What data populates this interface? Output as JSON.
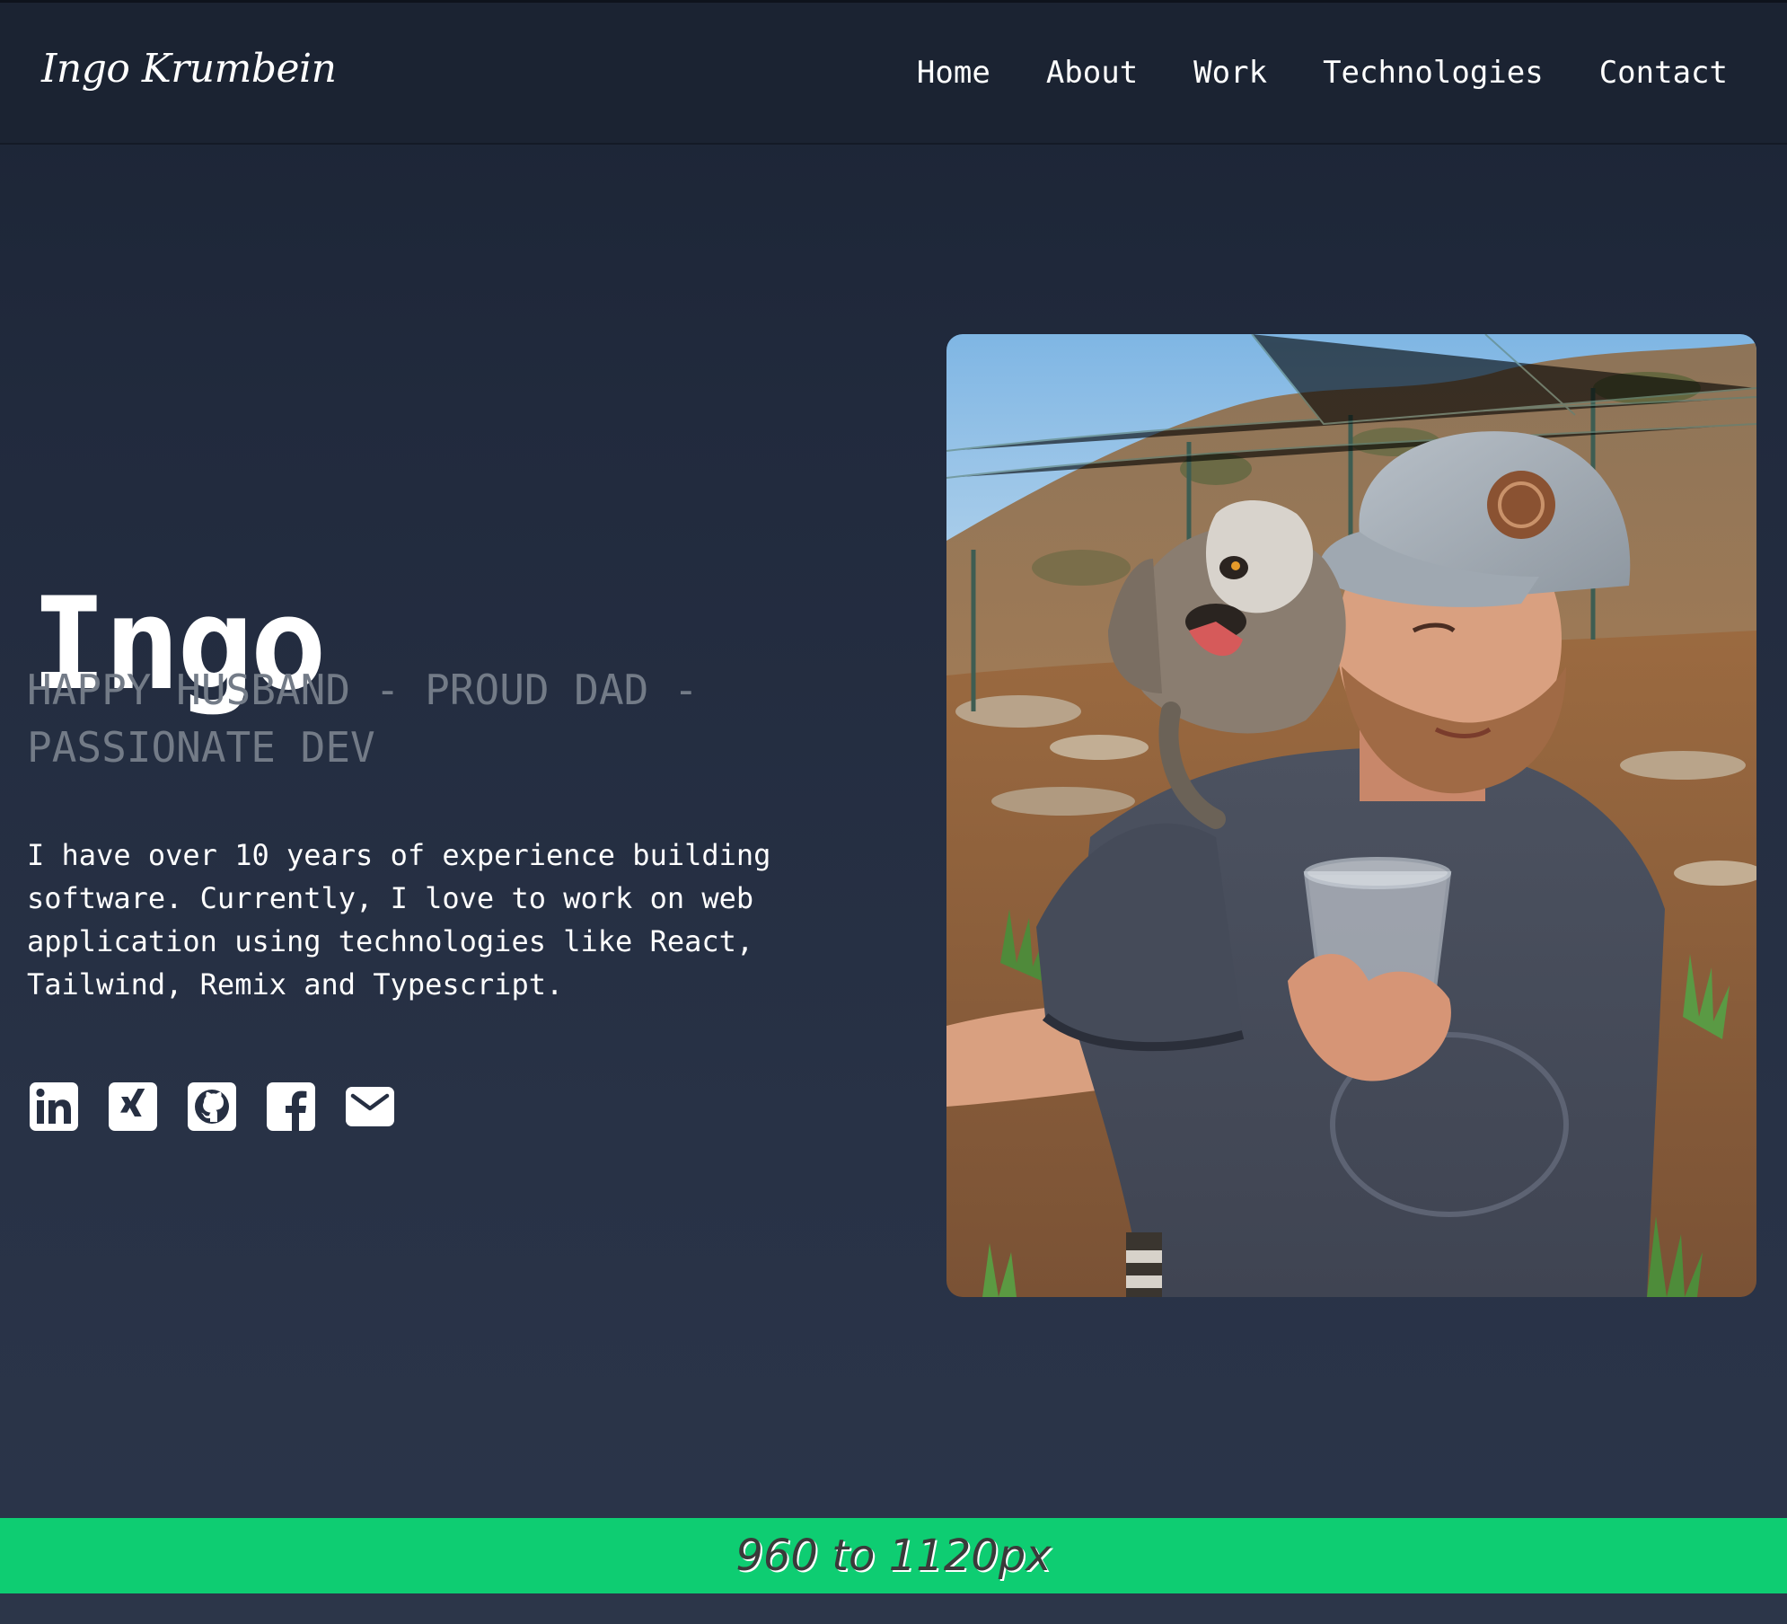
{
  "header": {
    "brand": "Ingo Krumbein",
    "nav": [
      "Home",
      "About",
      "Work",
      "Technologies",
      "Contact"
    ]
  },
  "hero": {
    "name": "Ingo",
    "tagline": "HAPPY HUSBAND - PROUD DAD - PASSIONATE DEV",
    "intro": "I have over 10 years of experience building software. Currently, I love to work on web application using technologies like React, Tailwind, Remix and Typescript."
  },
  "socials": [
    {
      "icon": "linkedin-icon"
    },
    {
      "icon": "xing-icon"
    },
    {
      "icon": "github-icon"
    },
    {
      "icon": "facebook-icon"
    },
    {
      "icon": "mail-icon"
    }
  ],
  "banner": {
    "text": "960 to 1120px"
  },
  "colors": {
    "header_bg": "#1b2332",
    "page_bg": "#252f42",
    "tagline": "#737b87",
    "banner_bg": "#0ecd72"
  }
}
